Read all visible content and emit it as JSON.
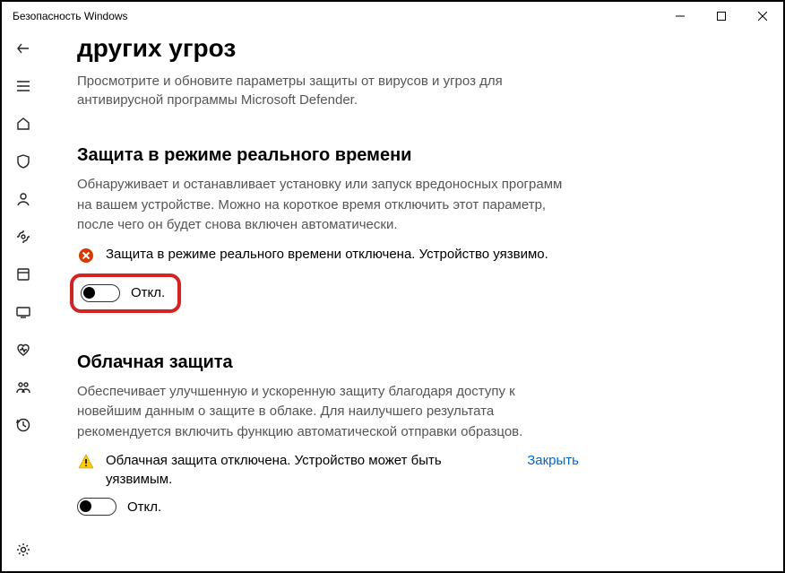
{
  "window": {
    "title": "Безопасность Windows"
  },
  "page": {
    "heading": "других угроз",
    "intro": "Просмотрите и обновите параметры защиты от вирусов и угроз для антивирусной программы Microsoft Defender."
  },
  "realtime": {
    "title": "Защита в режиме реального времени",
    "desc": "Обнаруживает и останавливает установку или запуск вредоносных программ на вашем устройстве. Можно на короткое время отключить этот параметр, после чего он будет снова включен автоматически.",
    "warning": "Защита в режиме реального времени отключена. Устройство уязвимо.",
    "toggle_label": "Откл."
  },
  "cloud": {
    "title": "Облачная защита",
    "desc": "Обеспечивает улучшенную и ускоренную защиту благодаря доступу к новейшим данным о защите в облаке. Для наилучшего результата рекомендуется включить функцию автоматической отправки образцов.",
    "warning": "Облачная защита отключена. Устройство может быть уязвимым.",
    "dismiss": "Закрыть",
    "toggle_label": "Откл."
  }
}
